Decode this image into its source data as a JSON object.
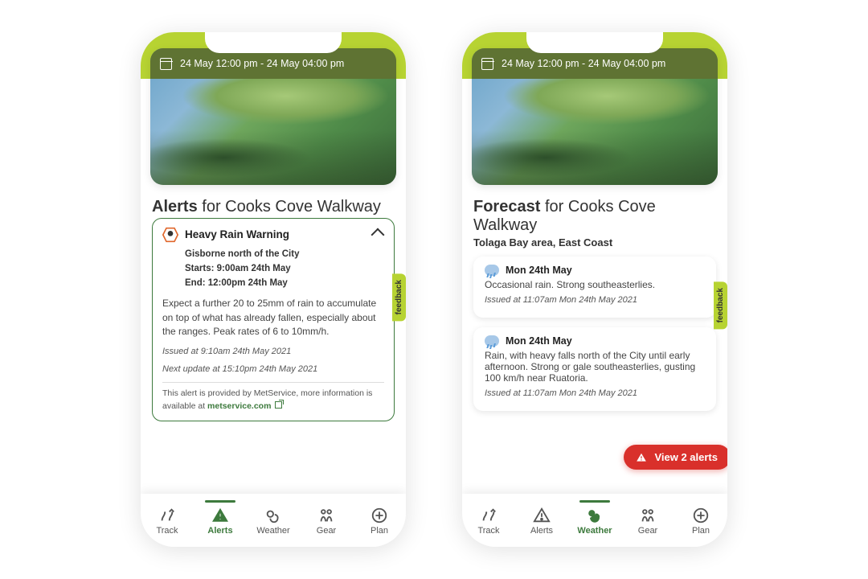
{
  "timebar_text": "24 May 12:00 pm - 24 May 04:00 pm",
  "feedback_label": "feedback",
  "alerts_screen": {
    "title_prefix": "Alerts",
    "title_for": "for Cooks Cove Walkway",
    "card": {
      "title": "Heavy Rain Warning",
      "region": "Gisborne north of the City",
      "starts": "Starts: 9:00am 24th May",
      "ends": "End: 12:00pm 24th May",
      "body": "Expect a further 20 to 25mm of rain to accumulate on top of what has already fallen, especially about the ranges. Peak rates of 6 to 10mm/h.",
      "issued": "Issued at 9:10am 24th May 2021",
      "next_update": "Next update at 15:10pm 24th May 2021",
      "provider_text": "This alert is provided by MetService, more information is available at ",
      "provider_link": "metservice.com"
    }
  },
  "forecast_screen": {
    "title_prefix": "Forecast",
    "title_for": "for Cooks Cove Walkway",
    "subtitle": "Tolaga Bay area, East Coast",
    "cards": [
      {
        "date": "Mon 24th May",
        "body": "Occasional rain. Strong southeasterlies.",
        "issued": "Issued at 11:07am Mon 24th May 2021"
      },
      {
        "date": "Mon 24th May",
        "body": "Rain, with heavy falls north of the City until early afternoon. Strong or gale southeasterlies, gusting 100 km/h near Ruatoria.",
        "issued": "Issued at 11:07am Mon 24th May 2021"
      }
    ],
    "view_alerts_label": "View 2 alerts"
  },
  "tabs": {
    "track": "Track",
    "alerts": "Alerts",
    "weather": "Weather",
    "gear": "Gear",
    "plan": "Plan"
  }
}
